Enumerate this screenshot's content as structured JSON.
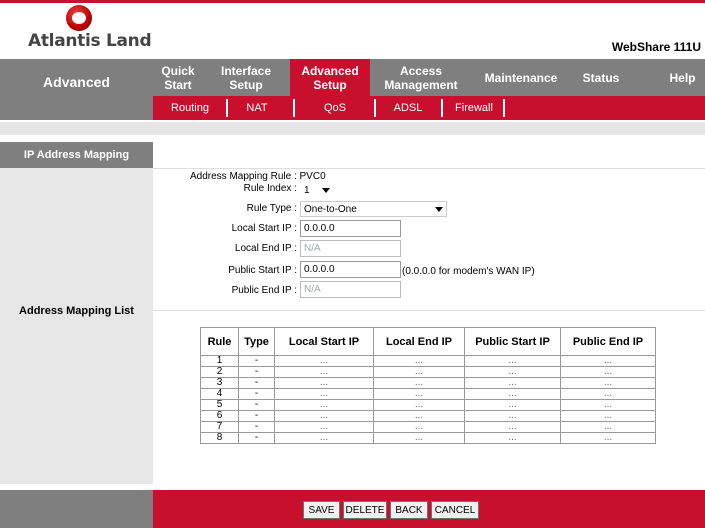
{
  "header": {
    "brand": "Atlantis Land",
    "product": "WebShare 111U"
  },
  "nav": {
    "section": "Advanced",
    "items": [
      {
        "line1": "Quick",
        "line2": "Start"
      },
      {
        "line1": "Interface",
        "line2": "Setup"
      },
      {
        "line1": "Advanced",
        "line2": "Setup"
      },
      {
        "line1": "Access",
        "line2": "Management"
      },
      {
        "line1": "Maintenance",
        "line2": ""
      },
      {
        "line1": "Status",
        "line2": ""
      },
      {
        "line1": "Help",
        "line2": ""
      }
    ],
    "active_index": 2
  },
  "subnav": [
    "Routing",
    "NAT",
    "QoS",
    "ADSL",
    "Firewall"
  ],
  "sidebar": {
    "heading": "IP Address Mapping",
    "section_label": "Address Mapping List"
  },
  "form": {
    "mapping_rule_label": "Address Mapping Rule : PVC0",
    "rule_index_label": "Rule Index :",
    "rule_index_value": "1",
    "rule_type_label": "Rule Type :",
    "rule_type_value": "One-to-One",
    "local_start_label": "Local Start IP :",
    "local_start_value": "0.0.0.0",
    "local_end_label": "Local End IP :",
    "local_end_value": "N/A",
    "public_start_label": "Public Start IP :",
    "public_start_value": "0.0.0.0",
    "public_start_hint": "(0.0.0.0 for modem's WAN IP)",
    "public_end_label": "Public End IP :",
    "public_end_value": "N/A"
  },
  "table": {
    "headers": [
      "Rule",
      "Type",
      "Local Start IP",
      "Local End IP",
      "Public Start IP",
      "Public End IP"
    ],
    "rows": [
      [
        "1",
        "-",
        "...",
        "...",
        "...",
        "..."
      ],
      [
        "2",
        "-",
        "...",
        "...",
        "...",
        "..."
      ],
      [
        "3",
        "-",
        "...",
        "...",
        "...",
        "..."
      ],
      [
        "4",
        "-",
        "...",
        "...",
        "...",
        "..."
      ],
      [
        "5",
        "-",
        "...",
        "...",
        "...",
        "..."
      ],
      [
        "6",
        "-",
        "...",
        "...",
        "...",
        "..."
      ],
      [
        "7",
        "-",
        "...",
        "...",
        "...",
        "..."
      ],
      [
        "8",
        "-",
        "...",
        "...",
        "...",
        "..."
      ]
    ]
  },
  "buttons": {
    "save": "SAVE",
    "delete": "DELETE",
    "back": "BACK",
    "cancel": "CANCEL"
  },
  "colors": {
    "brand_red": "#c8102e",
    "nav_gray": "#7f7f7f",
    "light_gray": "#e6e6e6"
  }
}
